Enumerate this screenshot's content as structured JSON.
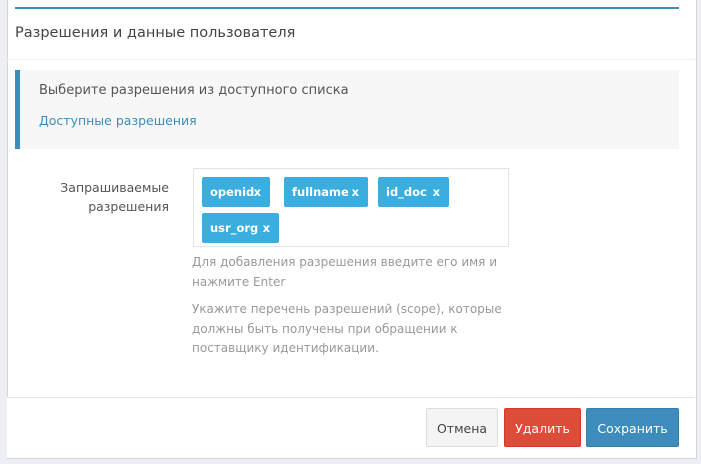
{
  "section": {
    "title": "Разрешения и данные пользователя"
  },
  "callout": {
    "text": "Выберите разрешения из доступного списка",
    "link": "Доступные разрешения"
  },
  "field": {
    "label": "Запрашиваемые разрешения",
    "tags": [
      {
        "label": "openid",
        "remove": "x"
      },
      {
        "label": "fullname",
        "remove": "x"
      },
      {
        "label": "id_doc",
        "remove": "x"
      },
      {
        "label": "usr_org",
        "remove": "x"
      }
    ],
    "help_add": "Для добавления разрешения введите его имя и нажмите Enter",
    "help_scope": "Укажите перечень разрешений (scope), которые должны быть получены при обращении к поставщику идентификации."
  },
  "buttons": {
    "cancel": "Отмена",
    "delete": "Удалить",
    "save": "Сохранить"
  },
  "colors": {
    "accent": "#3c8dbc",
    "tag": "#3aaedf",
    "danger": "#dd4b39"
  }
}
